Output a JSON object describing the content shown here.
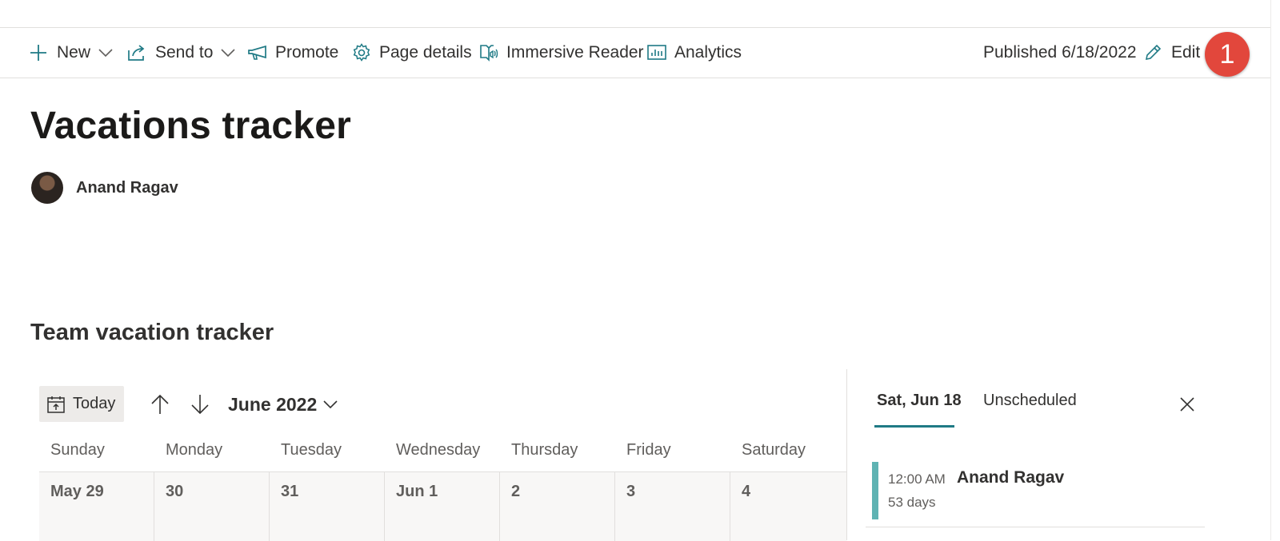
{
  "toolbar": {
    "new_label": "New",
    "send_to_label": "Send to",
    "promote_label": "Promote",
    "page_details_label": "Page details",
    "immersive_reader_label": "Immersive Reader",
    "analytics_label": "Analytics",
    "published_text": "Published 6/18/2022",
    "edit_label": "Edit",
    "accent_color": "#1f7a85"
  },
  "annotation_badge": {
    "text": "1",
    "color": "#e2473c"
  },
  "page": {
    "title": "Vacations tracker",
    "author": "Anand Ragav"
  },
  "calendar_section": {
    "heading": "Team vacation tracker",
    "today_label": "Today",
    "month_label": "June 2022",
    "weekdays": [
      "Sunday",
      "Monday",
      "Tuesday",
      "Wednesday",
      "Thursday",
      "Friday",
      "Saturday"
    ],
    "first_week_dates": [
      "May 29",
      "30",
      "31",
      "Jun 1",
      "2",
      "3",
      "4"
    ]
  },
  "side_panel": {
    "tabs": [
      "Sat, Jun 18",
      "Unscheduled"
    ],
    "active_tab": "Sat, Jun 18",
    "event": {
      "time": "12:00 AM",
      "person": "Anand Ragav",
      "duration": "53 days",
      "color": "#5fb3b3"
    }
  }
}
